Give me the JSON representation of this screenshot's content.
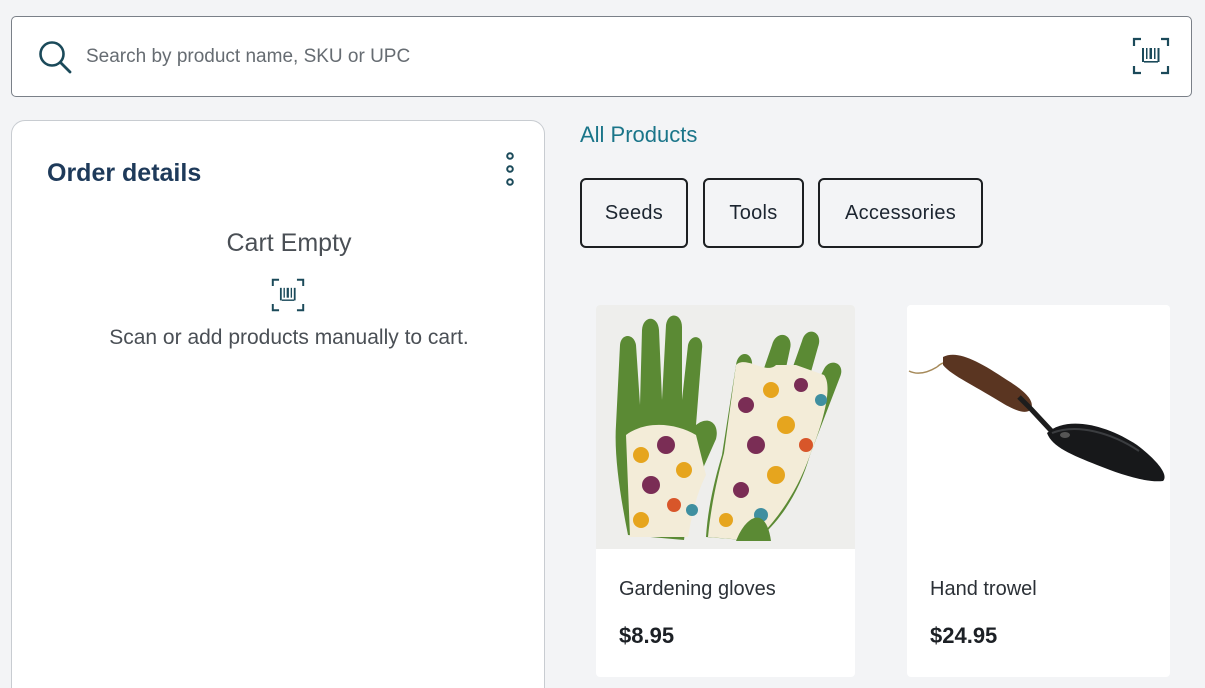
{
  "search": {
    "placeholder": "Search by product name, SKU or UPC",
    "value": ""
  },
  "order": {
    "title": "Order details",
    "empty_title": "Cart Empty",
    "empty_hint": "Scan or add products manually to cart."
  },
  "catalog": {
    "breadcrumb": "All Products",
    "categories": [
      "Seeds",
      "Tools",
      "Accessories"
    ],
    "products": [
      {
        "name": "Gardening gloves",
        "price": "$8.95"
      },
      {
        "name": "Hand trowel",
        "price": "$24.95"
      }
    ]
  },
  "icons": {
    "search": "search-icon",
    "barcode": "barcode-scan-icon",
    "menu": "kebab-menu-icon"
  },
  "colors": {
    "background": "#f3f4f6",
    "accent": "#1a7589",
    "title": "#1e3a5a",
    "icon": "#1b4a5a"
  }
}
